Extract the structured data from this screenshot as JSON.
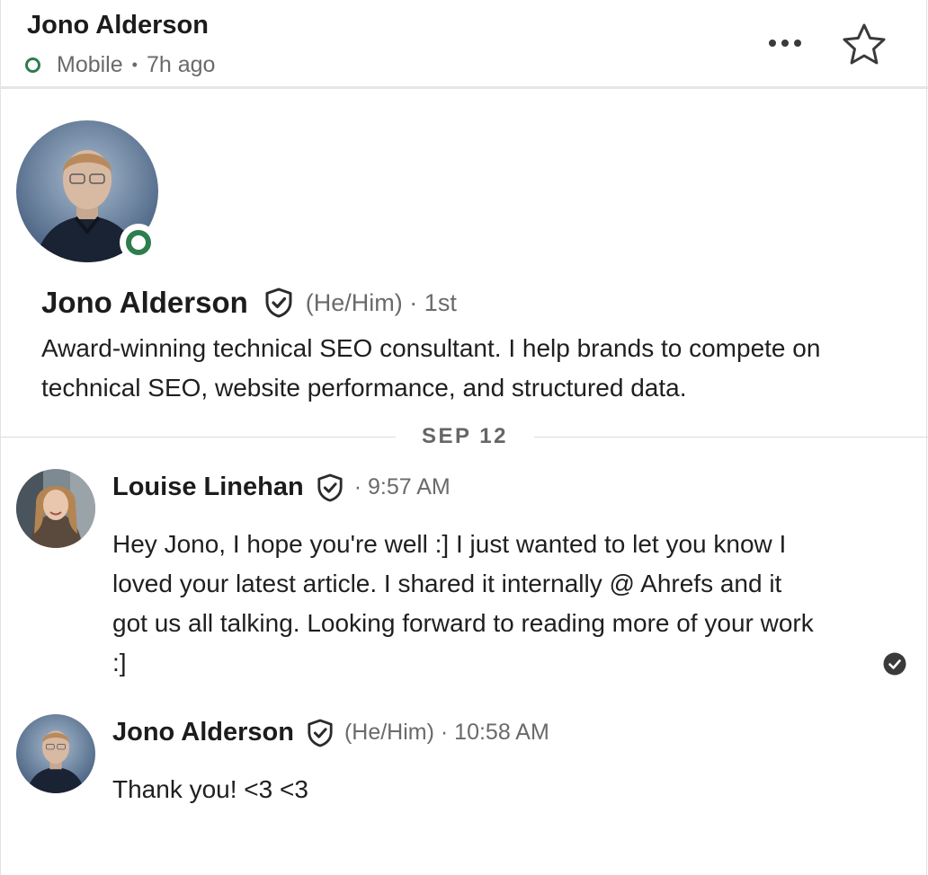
{
  "header": {
    "name": "Jono Alderson",
    "status": "Mobile",
    "last_active": "7h ago"
  },
  "profile": {
    "name": "Jono Alderson",
    "pronouns": "(He/Him)",
    "degree": "1st",
    "headline": "Award-winning technical SEO consultant. I help brands to compete on technical SEO, website performance, and structured data."
  },
  "date_divider": "SEP 12",
  "messages": [
    {
      "sender": "Louise Linehan",
      "time": "9:57 AM",
      "text": "Hey Jono, I hope you're well :] I just wanted to let you know I loved your latest article. I shared it internally @ Ahrefs and it got us all talking. Looking forward to reading more of your work :]"
    },
    {
      "sender": "Jono Alderson",
      "pronouns": "(He/Him)",
      "time": "10:58 AM",
      "text": "Thank you! <3 <3"
    }
  ],
  "colors": {
    "online_green": "#2e7d4f",
    "text_primary": "#1f1f1f",
    "text_secondary": "#6a6a6a",
    "divider": "#dcdcdc"
  },
  "icons": {
    "more": "more-horizontal-icon",
    "star": "star-outline-icon",
    "verified": "verified-shield-icon",
    "read": "read-receipt-check-icon"
  }
}
